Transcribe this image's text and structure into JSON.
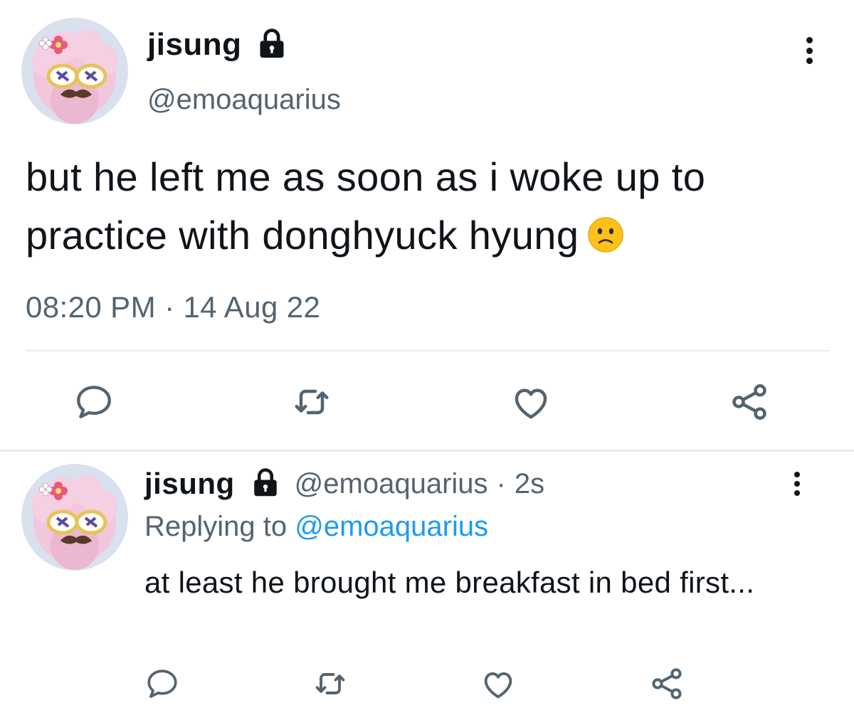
{
  "tweet": {
    "author_name": "jisung",
    "author_handle": "@emoaquarius",
    "text": "but he left me as soon as i woke up to practice with donghyuck hyung",
    "emoji": "confused-face",
    "time": "08:20 PM",
    "separator": "·",
    "date": "14 Aug 22",
    "actions": [
      "reply-icon",
      "retweet-icon",
      "like-icon",
      "share-icon"
    ]
  },
  "reply": {
    "author_name": "jisung",
    "author_handle": "@emoaquarius",
    "separator": "·",
    "age": "2s",
    "replying_prefix": "Replying to",
    "replying_to": "@emoaquarius",
    "text": "at least he brought me breakfast in bed first...",
    "actions": [
      "reply-icon",
      "retweet-icon",
      "like-icon",
      "share-icon"
    ]
  },
  "colors": {
    "text_primary": "#0f1419",
    "text_secondary": "#536471",
    "link": "#1d9bf0",
    "divider": "#e7e9ea"
  }
}
